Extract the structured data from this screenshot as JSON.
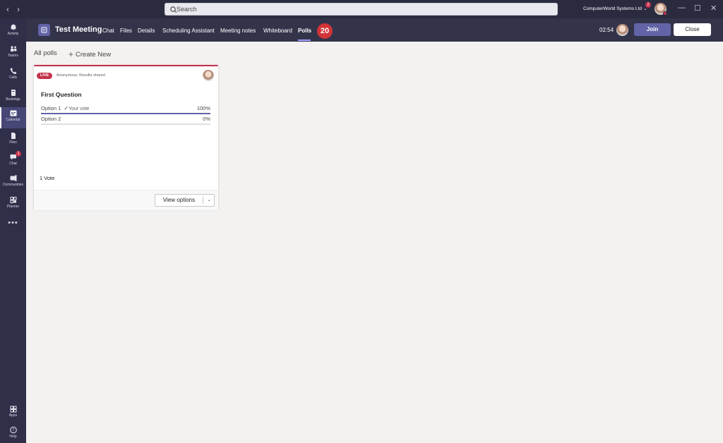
{
  "titlebar": {
    "back_icon": "chevron-left-icon",
    "forward_icon": "chevron-right-icon",
    "search_placeholder": "Search",
    "org_name": "ComputerWorld Systems Ltd",
    "org_badge": "2",
    "minimize": "—",
    "maximize": "☐",
    "close": "✕"
  },
  "rail": {
    "items": [
      {
        "label": "Activity",
        "icon": "bell-icon"
      },
      {
        "label": "Teams",
        "icon": "teams-icon"
      },
      {
        "label": "Calls",
        "icon": "phone-icon"
      },
      {
        "label": "Bookings",
        "icon": "bookings-icon"
      },
      {
        "label": "Calendar",
        "icon": "calendar-icon",
        "active": true
      },
      {
        "label": "Files",
        "icon": "files-icon"
      },
      {
        "label": "Chat",
        "icon": "chat-icon",
        "badge": "1"
      },
      {
        "label": "Communities",
        "icon": "communities-icon"
      },
      {
        "label": "Planner",
        "icon": "planner-icon"
      }
    ],
    "more": "•••",
    "bottom": [
      {
        "label": "Apps",
        "icon": "apps-icon"
      },
      {
        "label": "Help",
        "icon": "help-icon"
      }
    ]
  },
  "meeting": {
    "title": "Test Meeting",
    "tabs": [
      "Chat",
      "Files",
      "Details",
      "Scheduling Assistant",
      "Meeting notes",
      "Whiteboard",
      "Polls"
    ],
    "active_tab": "Polls",
    "step_badge": "20",
    "timer": "02:54",
    "join_label": "Join",
    "close_label": "Close"
  },
  "polls": {
    "all_polls_label": "All polls",
    "create_new_label": "Create New",
    "card": {
      "status": "LIVE",
      "visibility": "Anonymous; Results shared",
      "question": "First Question",
      "options": [
        {
          "label": "Option 1",
          "your_vote": "Your vote",
          "percent": "100%",
          "fill": 1.0
        },
        {
          "label": "Option 2",
          "your_vote": "",
          "percent": "0%",
          "fill": 0.0
        }
      ],
      "votes": "1 Vote",
      "view_options_label": "View options"
    }
  },
  "colors": {
    "accent": "#6264a7",
    "live_red": "#c4314b",
    "rail_bg": "#2f2f4a",
    "header_bg": "#33344a"
  }
}
